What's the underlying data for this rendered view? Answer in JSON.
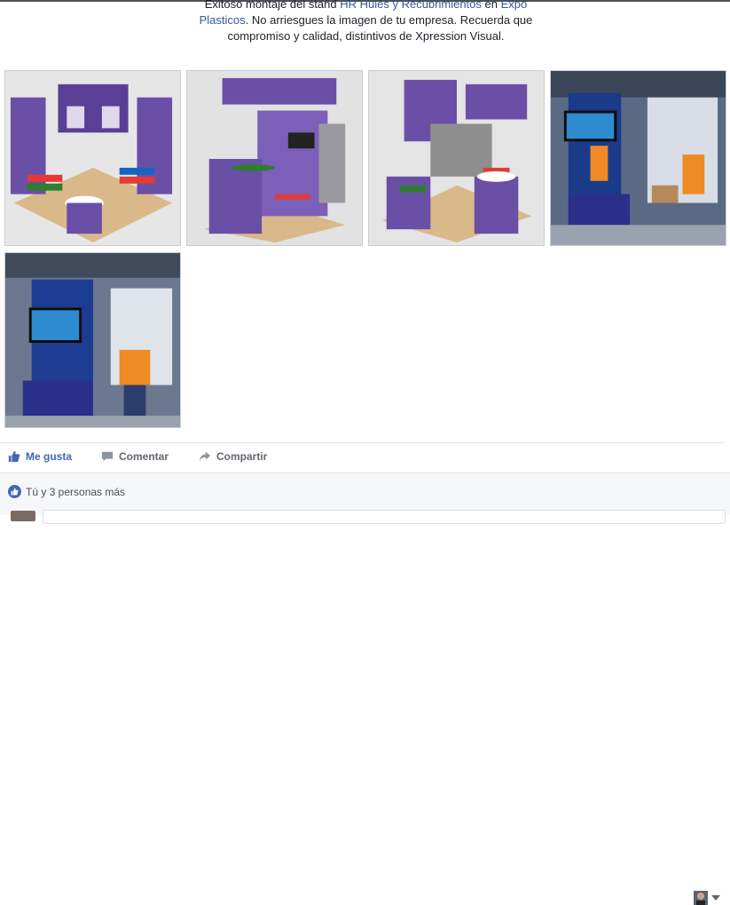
{
  "post": {
    "caption_lines": {
      "line1_start": "Exitoso montaje del stand ",
      "link_company": "HR Hules y Recubrimientos",
      "line1_mid": " en ",
      "link_event_part1": "Expo",
      "link_event_part2": "Plasticos",
      "line2_rest": ". No arriesgues la imagen de tu empresa. Recuerda que",
      "line3": "compromiso y calidad, distintivos de Xpression Visual."
    },
    "photos": [
      {
        "label": "stand render 1"
      },
      {
        "label": "stand render 2"
      },
      {
        "label": "stand render 3"
      },
      {
        "label": "stand montage photo 1"
      },
      {
        "label": "stand montage photo 2"
      }
    ]
  },
  "actions": {
    "like_label": "Me gusta",
    "comment_label": "Comentar",
    "share_label": "Compartir"
  },
  "feedback": {
    "reactions_text": "Tú y 3 personas más"
  },
  "icons": {
    "like": "thumbs-up-icon",
    "comment": "comment-bubble-icon",
    "share": "share-arrow-icon",
    "caret": "chevron-down-icon"
  },
  "colors": {
    "link": "#365899",
    "like_blue": "#4267b2",
    "stand_purple": "#6a4fa6"
  }
}
